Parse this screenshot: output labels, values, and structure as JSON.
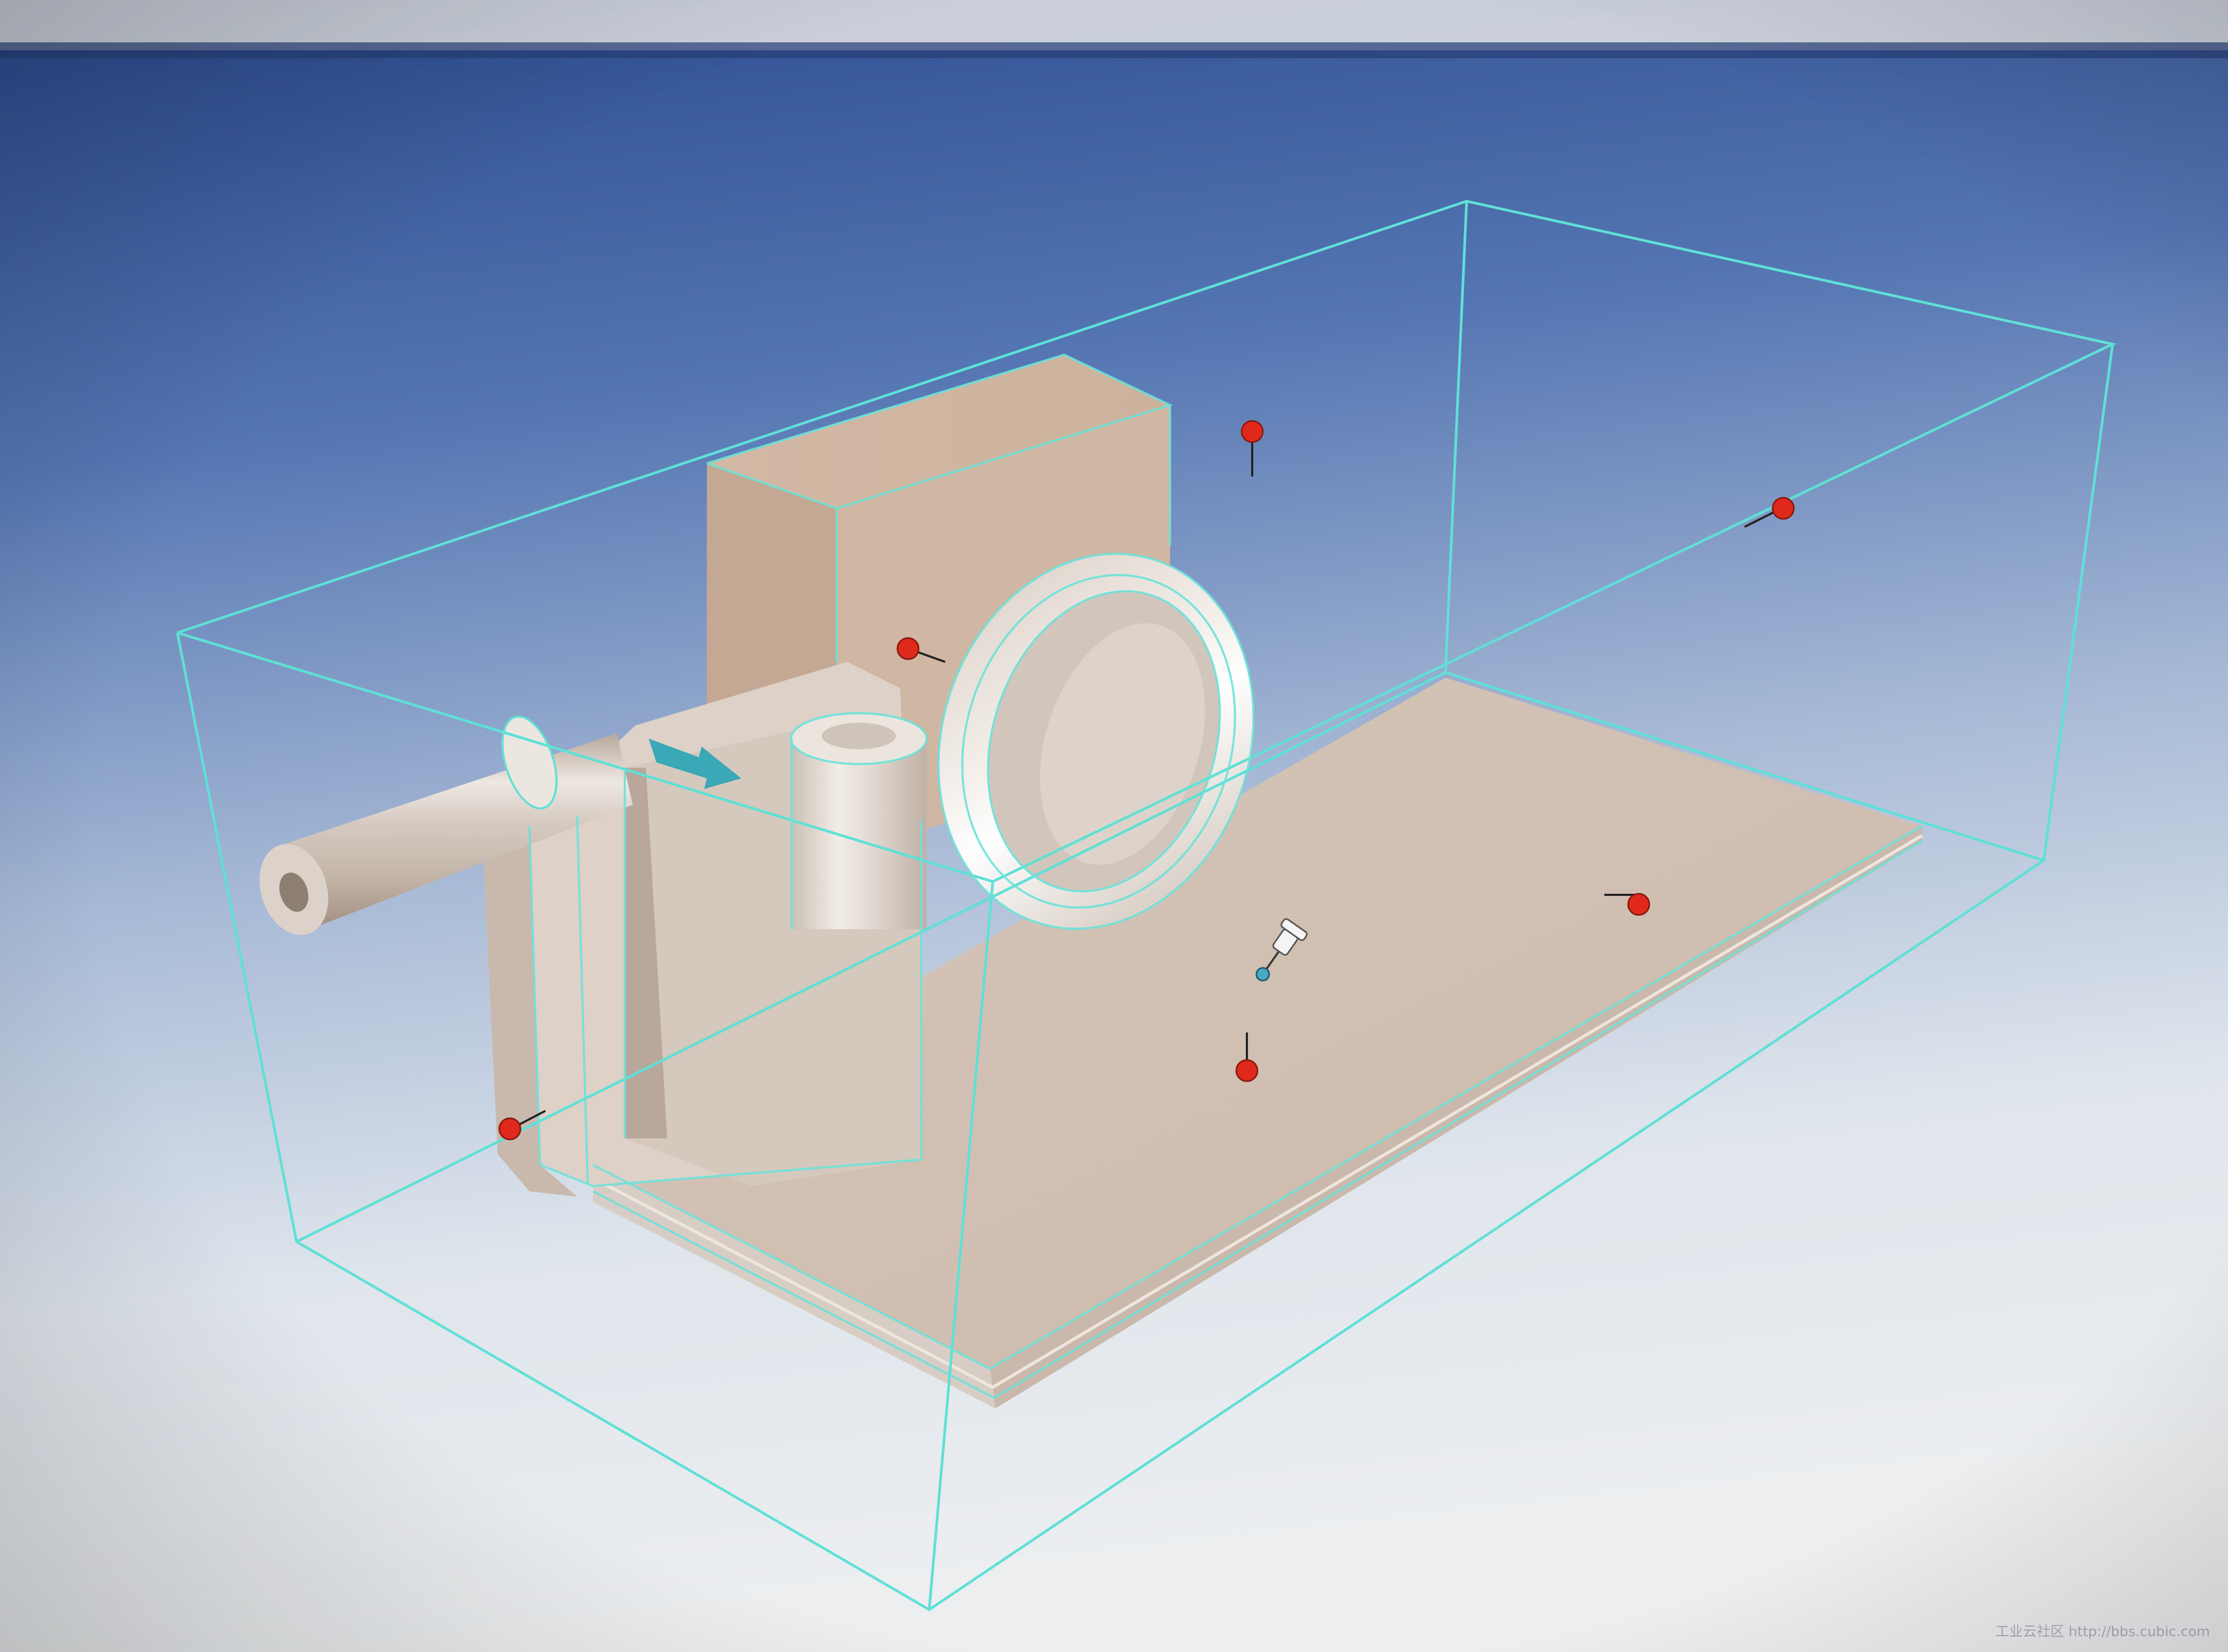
{
  "app": {
    "view": "3D part viewport",
    "display_mode": "shaded with edges"
  },
  "scene": {
    "part_color": "#d3c6bb",
    "part_shadow_color": "#a89484",
    "bounding_box_color": "#5fe0d6",
    "selection_marker_color": "#e0291b",
    "background_top": "#2b4e92",
    "background_bottom": "#e9ecef",
    "handles": [
      {
        "name": "top-face-handle",
        "icon": "sphere-handle-icon"
      },
      {
        "name": "back-face-handle",
        "icon": "sphere-handle-icon"
      },
      {
        "name": "front-upper-handle",
        "icon": "sphere-handle-icon"
      },
      {
        "name": "right-face-handle",
        "icon": "sphere-handle-icon"
      },
      {
        "name": "bottom-face-handle",
        "icon": "sphere-handle-icon"
      },
      {
        "name": "left-face-handle",
        "icon": "sphere-handle-icon"
      }
    ],
    "cursor_icon": "pushpin-cursor-icon",
    "direction_arrow_icon": "arrow-right-icon"
  },
  "watermark": {
    "text": "工业云社区 http://bbs.cubic.com"
  }
}
